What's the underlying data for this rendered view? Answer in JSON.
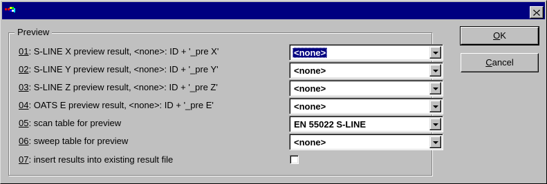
{
  "dialog": {
    "title": "",
    "group_title": "Preview"
  },
  "rows": [
    {
      "num": "01",
      "text": ": S-LINE X preview result, <none>: ID + '_pre X'",
      "value": "<none>"
    },
    {
      "num": "02",
      "text": ": S-LINE Y preview result, <none>: ID + '_pre Y'",
      "value": "<none>"
    },
    {
      "num": "03",
      "text": ": S-LINE Z preview result, <none>: ID + '_pre Z'",
      "value": "<none>"
    },
    {
      "num": "04",
      "text": ": OATS E preview result, <none>: ID + '_pre E'",
      "value": "<none>"
    },
    {
      "num": "05",
      "text": ": scan table for preview",
      "value": "EN 55022 S-LINE"
    },
    {
      "num": "06",
      "text": ": sweep table for preview",
      "value": "<none>"
    },
    {
      "num": "07",
      "text": ": insert results into existing result file",
      "checked": false
    }
  ],
  "buttons": {
    "ok_prefix": "O",
    "ok_rest": "K",
    "cancel_prefix": "C",
    "cancel_rest": "ancel"
  },
  "icons": {
    "app": "app-icon",
    "close": "close-icon",
    "dropdown": "chevron-down-icon"
  },
  "colors": {
    "titlebar": "#000080",
    "face": "#c0c0c0",
    "selection": "#000080"
  }
}
